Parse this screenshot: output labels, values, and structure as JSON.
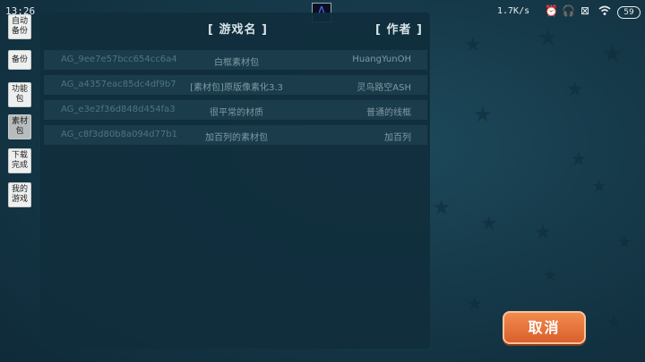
{
  "status_bar": {
    "time": "13:26",
    "net_speed": "1.7K/s",
    "battery": "59",
    "app_icon": "app-glyph-icon"
  },
  "sidebar": {
    "items": [
      {
        "label": "自动备份"
      },
      {
        "label": "备份"
      },
      {
        "label": "功能包"
      },
      {
        "label": "素材包",
        "active": true
      },
      {
        "label": "下载完成"
      },
      {
        "label": "我的游戏"
      }
    ]
  },
  "table": {
    "headers": {
      "name": "[ 游戏名 ]",
      "author": "[ 作者 ]"
    },
    "rows": [
      {
        "id": "AG_9ee7e57bcc654cc6a4",
        "name": "白框素材包",
        "author": "HuangYunOH"
      },
      {
        "id": "AG_a4357eac85dc4df9b7",
        "name": "[素材包]原版像素化3.3",
        "author": "灵鸟路空ASH"
      },
      {
        "id": "AG_e3e2f36d848d454fa3",
        "name": "很平常的材质",
        "author": "普通的线框"
      },
      {
        "id": "AG_c8f3d80b8a094d77b1",
        "name": "加百列的素材包",
        "author": "加百列"
      }
    ]
  },
  "actions": {
    "cancel_label": "取消"
  },
  "colors": {
    "background": "#163a4a",
    "panel": "#102e3c",
    "row": "#1c3e4d",
    "cancel_button": "#e8703a"
  }
}
